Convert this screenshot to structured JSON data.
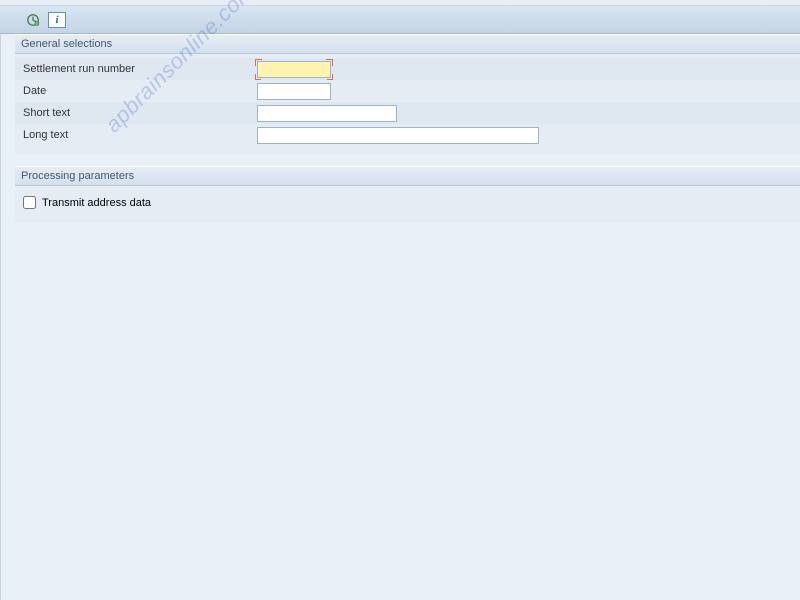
{
  "toolbar": {
    "execute_name": "execute-icon",
    "info_name": "info-icon"
  },
  "sections": {
    "general": {
      "title": "General selections",
      "fields": {
        "run_number": {
          "label": "Settlement run number",
          "value": ""
        },
        "date": {
          "label": "Date",
          "value": ""
        },
        "short_text": {
          "label": "Short text",
          "value": ""
        },
        "long_text": {
          "label": "Long text",
          "value": ""
        }
      }
    },
    "processing": {
      "title": "Processing parameters",
      "transmit_address": {
        "label": "Transmit address data",
        "checked": false
      }
    }
  },
  "watermark": "apbrainsonline.com"
}
